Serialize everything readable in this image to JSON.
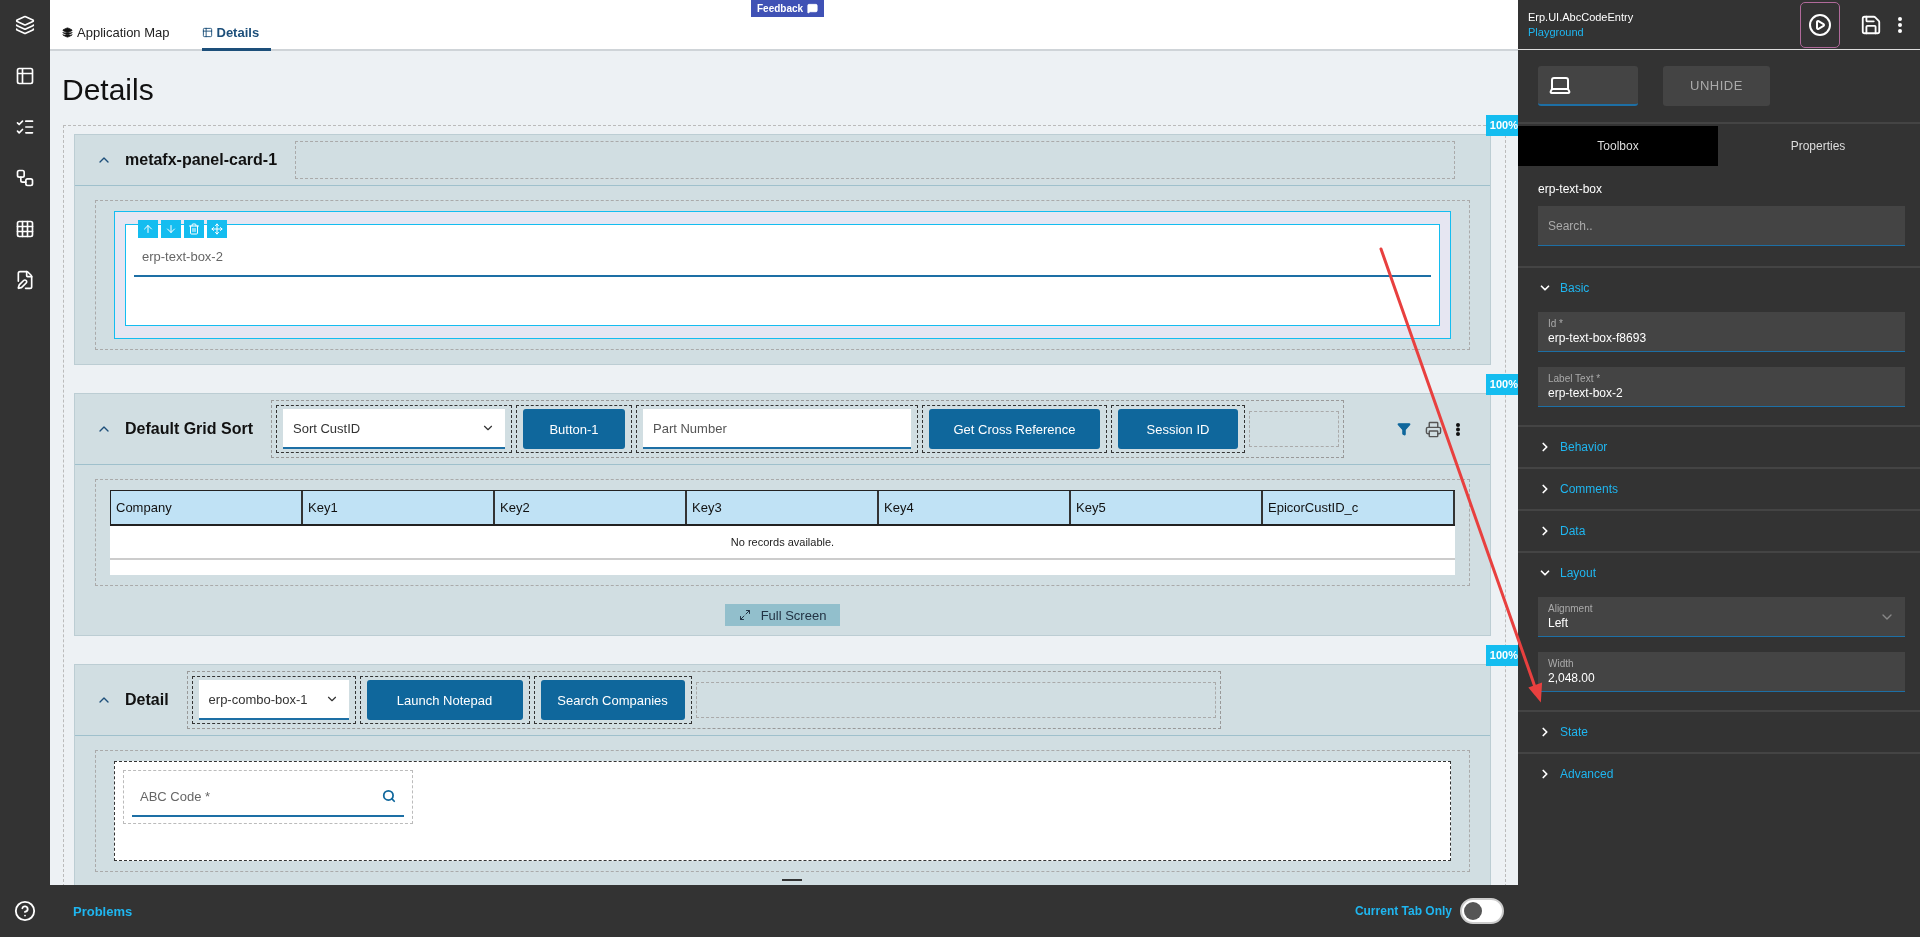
{
  "tabs": [
    {
      "label": "Application Map",
      "selected": false
    },
    {
      "label": "Details",
      "selected": true
    }
  ],
  "feedback": "Feedback",
  "page_title": "Details",
  "panels": [
    {
      "kind": "form",
      "title": "metafx-panel-card-1",
      "expanded": true,
      "badge": "100%",
      "field": {
        "label": "erp-text-box-2",
        "selected": true,
        "lookup": false
      }
    },
    {
      "kind": "grid",
      "title": "Default Grid Sort",
      "expanded": true,
      "badge": "100%",
      "header_controls": [
        {
          "kind": "select",
          "value": "Sort CustID"
        },
        {
          "kind": "button",
          "label": "Button-1"
        },
        {
          "kind": "input",
          "placeholder": "Part Number"
        },
        {
          "kind": "button",
          "label": "Get Cross Reference"
        },
        {
          "kind": "button",
          "label": "Session ID"
        }
      ],
      "columns": [
        "Company",
        "Key1",
        "Key2",
        "Key3",
        "Key4",
        "Key5",
        "EpicorCustID_c"
      ],
      "empty_message": "No records available.",
      "full_screen": "Full Screen"
    },
    {
      "kind": "form",
      "title": "Detail",
      "expanded": true,
      "badge": "100%",
      "header_controls": [
        {
          "kind": "select",
          "value": "erp-combo-box-1"
        },
        {
          "kind": "button",
          "label": "Launch Notepad"
        },
        {
          "kind": "button",
          "label": "Search Companies"
        }
      ],
      "field": {
        "label": "ABC Code *",
        "selected": false,
        "lookup": true
      }
    }
  ],
  "problems": {
    "title": "Problems",
    "toggle_label": "Current Tab Only",
    "toggle_on": false
  },
  "inspector": {
    "app_name": "Erp.UI.AbcCodeEntry",
    "workspace": "Playground",
    "view_buttons": [
      {
        "kind": "device",
        "selected": true
      },
      {
        "kind": "text",
        "label": "UNHIDE",
        "selected": false
      }
    ],
    "tabs": [
      {
        "label": "Toolbox",
        "selected": true
      },
      {
        "label": "Properties",
        "selected": false
      }
    ],
    "component": "erp-text-box",
    "search": {
      "placeholder": "Search.."
    },
    "sections": [
      {
        "title": "Basic",
        "expanded": true,
        "fields": [
          {
            "kind": "text",
            "label": "Id *",
            "value": "erp-text-box-f8693"
          },
          {
            "kind": "text",
            "label": "Label Text *",
            "value": "erp-text-box-2"
          }
        ]
      },
      {
        "title": "Behavior",
        "expanded": false
      },
      {
        "title": "Comments",
        "expanded": false
      },
      {
        "title": "Data",
        "expanded": false
      },
      {
        "title": "Layout",
        "expanded": true,
        "fields": [
          {
            "kind": "select",
            "label": "Alignment",
            "value": "Left"
          },
          {
            "kind": "text",
            "label": "Width",
            "value": "2,048.00"
          }
        ]
      },
      {
        "title": "State",
        "expanded": false
      },
      {
        "title": "Advanced",
        "expanded": false
      }
    ]
  }
}
